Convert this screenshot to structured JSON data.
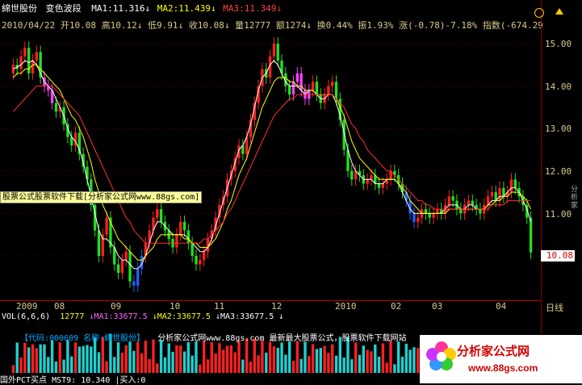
{
  "header": {
    "stock_name": "綿世股份",
    "indicator_name": "变色波段",
    "ma1": "MA1:11.316",
    "ma2": "MA2:11.439",
    "ma3": "MA3:11.349",
    "ma1_color": "#ffffff",
    "ma2_color": "#ffff00",
    "ma3_color": "#ff4040"
  },
  "quote": {
    "date": "2010/04/22",
    "open": "开10.08",
    "high": "高10.12",
    "low": "低9.91",
    "close": "收10.08",
    "volume": "量12777",
    "amount": "额1274",
    "turnover": "换0.44%",
    "amplitude": "振1.93%",
    "change": "涨(-0.78)-7.18%",
    "index": "指数(-674.29"
  },
  "price_axis": {
    "labels": [
      "15.00",
      "14.00",
      "13.00",
      "12.00",
      "11.00",
      "10.00"
    ],
    "current": "10.08"
  },
  "time_axis": {
    "labels": [
      "2009",
      "08",
      "09",
      "10",
      "11",
      "12",
      "2010",
      "02",
      "03",
      "04"
    ],
    "period": "日线"
  },
  "volume_row": {
    "label": "VOL(6,6,6)",
    "value": "12777",
    "ma1": "MA1:33677.5",
    "ma2": "MA2:33677.5",
    "ma3": "MA3:33677.5"
  },
  "ad_overlay": "股票公式股票软件下载[分析家公式网www.88gs.com]",
  "banner": {
    "code_text": "【代码:000609 名称:綿世股份】",
    "site_text": "分析家公式网www.88gs.com 最新最大股票公式，股票软件下载网站"
  },
  "logo": {
    "name": "分析家公式网",
    "url": "www.88gs.com"
  },
  "bottom_row": "国外PCT买点  MST9: 10.340 |买入:0",
  "right_side_text": "分析家",
  "chart_data": {
    "type": "candlestick",
    "title": "",
    "ylim": [
      9.0,
      15.5
    ],
    "y_ticks": [
      10,
      11,
      12,
      13,
      14,
      15
    ],
    "x_labels": [
      "2009",
      "08",
      "09",
      "10",
      "11",
      "12",
      "2010",
      "02",
      "03",
      "04"
    ],
    "closes": [
      14.5,
      14.4,
      14.7,
      14.9,
      14.3,
      14.6,
      14.8,
      14.2,
      14.0,
      13.9,
      13.6,
      13.4,
      13.5,
      13.1,
      12.8,
      12.6,
      12.9,
      12.4,
      12.1,
      11.8,
      11.2,
      10.6,
      10.0,
      10.5,
      10.9,
      10.2,
      9.8,
      9.6,
      9.9,
      10.1,
      9.4,
      9.3,
      9.7,
      10.0,
      10.3,
      10.6,
      10.9,
      11.1,
      10.8,
      10.6,
      10.4,
      10.2,
      10.5,
      10.8,
      10.6,
      10.3,
      10.0,
      9.8,
      9.9,
      10.1,
      10.4,
      10.6,
      10.9,
      11.2,
      11.4,
      11.8,
      12.0,
      12.3,
      12.6,
      12.4,
      12.8,
      13.2,
      13.6,
      14.0,
      14.4,
      14.2,
      14.7,
      15.0,
      14.6,
      14.3,
      14.0,
      13.8,
      14.1,
      14.3,
      13.9,
      13.7,
      13.9,
      14.1,
      13.8,
      13.6,
      13.8,
      14.0,
      14.1,
      13.7,
      13.2,
      12.5,
      12.0,
      11.8,
      12.0,
      11.9,
      11.7,
      11.8,
      11.9,
      11.7,
      11.6,
      11.7,
      11.8,
      12.0,
      11.9,
      11.7,
      11.5,
      11.3,
      11.0,
      10.8,
      10.9,
      11.1,
      11.0,
      10.9,
      11.0,
      11.1,
      11.0,
      11.2,
      11.4,
      11.3,
      11.1,
      11.0,
      11.2,
      11.3,
      11.2,
      11.1,
      11.0,
      11.2,
      11.4,
      11.5,
      11.3,
      11.6,
      11.4,
      11.5,
      11.8,
      11.6,
      11.4,
      11.2,
      10.9,
      10.08
    ],
    "ma1": [
      14.4,
      14.45,
      14.5,
      14.6,
      14.55,
      14.6,
      14.5,
      14.3,
      14.1,
      14.0,
      13.9,
      13.7,
      13.5,
      13.3,
      13.0,
      12.8,
      12.7,
      12.5,
      12.2,
      11.8,
      11.4,
      11.0,
      10.6,
      10.4,
      10.4,
      10.3,
      10.2,
      10.0,
      9.9,
      9.9,
      9.8,
      9.7,
      9.7,
      9.8,
      10.0,
      10.3,
      10.6,
      10.8,
      10.8,
      10.7,
      10.6,
      10.5,
      10.5,
      10.5,
      10.5,
      10.4,
      10.3,
      10.2,
      10.1,
      10.1,
      10.2,
      10.4,
      10.7,
      11.0,
      11.3,
      11.6,
      11.9,
      12.2,
      12.5,
      12.6,
      12.8,
      13.1,
      13.5,
      13.9,
      14.2,
      14.3,
      14.5,
      14.6,
      14.5,
      14.3,
      14.1,
      14.0,
      14.0,
      14.0,
      13.9,
      13.8,
      13.9,
      13.9,
      13.8,
      13.7,
      13.7,
      13.8,
      13.8,
      13.6,
      13.3,
      12.9,
      12.5,
      12.2,
      12.0,
      11.9,
      11.8,
      11.8,
      11.8,
      11.7,
      11.7,
      11.7,
      11.8,
      11.8,
      11.8,
      11.7,
      11.5,
      11.3,
      11.1,
      11.0,
      11.0,
      11.0,
      11.0,
      11.0,
      11.0,
      11.0,
      11.0,
      11.1,
      11.2,
      11.2,
      11.2,
      11.1,
      11.1,
      11.2,
      11.2,
      11.1,
      11.1,
      11.1,
      11.2,
      11.3,
      11.3,
      11.4,
      11.4,
      11.5,
      11.6,
      11.6,
      11.5,
      11.3,
      11.1,
      10.8
    ],
    "ma2": [
      14.2,
      14.3,
      14.3,
      14.4,
      14.4,
      14.5,
      14.5,
      14.4,
      14.3,
      14.2,
      14.1,
      14.0,
      13.9,
      13.7,
      13.5,
      13.3,
      13.2,
      13.0,
      12.8,
      12.5,
      12.2,
      11.8,
      11.5,
      11.2,
      11.0,
      10.8,
      10.6,
      10.4,
      10.3,
      10.2,
      10.1,
      10.0,
      9.9,
      9.9,
      10.0,
      10.1,
      10.2,
      10.4,
      10.5,
      10.5,
      10.5,
      10.5,
      10.5,
      10.5,
      10.4,
      10.4,
      10.3,
      10.3,
      10.2,
      10.2,
      10.2,
      10.3,
      10.4,
      10.6,
      10.8,
      11.1,
      11.3,
      11.6,
      11.9,
      12.1,
      12.3,
      12.6,
      12.9,
      13.2,
      13.5,
      13.7,
      13.9,
      14.1,
      14.2,
      14.2,
      14.2,
      14.1,
      14.1,
      14.0,
      14.0,
      13.9,
      13.9,
      13.9,
      13.8,
      13.8,
      13.8,
      13.8,
      13.8,
      13.7,
      13.5,
      13.3,
      13.0,
      12.7,
      12.5,
      12.3,
      12.2,
      12.1,
      12.0,
      11.9,
      11.8,
      11.8,
      11.8,
      11.8,
      11.8,
      11.7,
      11.6,
      11.5,
      11.3,
      11.2,
      11.1,
      11.0,
      11.0,
      11.0,
      11.0,
      11.0,
      11.0,
      11.0,
      11.1,
      11.1,
      11.1,
      11.1,
      11.1,
      11.1,
      11.1,
      11.1,
      11.1,
      11.1,
      11.2,
      11.2,
      11.3,
      11.3,
      11.4,
      11.4,
      11.5,
      11.5,
      11.5,
      11.4,
      11.3,
      11.1
    ],
    "ma3": [
      13.4,
      13.5,
      13.6,
      13.7,
      13.8,
      13.9,
      14.0,
      14.0,
      14.0,
      14.0,
      14.0,
      13.9,
      13.8,
      13.7,
      13.6,
      13.5,
      13.4,
      13.3,
      13.1,
      12.9,
      12.7,
      12.5,
      12.3,
      12.1,
      11.9,
      11.7,
      11.5,
      11.3,
      11.1,
      10.9,
      10.8,
      10.6,
      10.5,
      10.4,
      10.3,
      10.3,
      10.3,
      10.3,
      10.3,
      10.3,
      10.3,
      10.3,
      10.3,
      10.3,
      10.3,
      10.3,
      10.3,
      10.3,
      10.3,
      10.4,
      10.4,
      10.5,
      10.6,
      10.7,
      10.8,
      11.0,
      11.1,
      11.3,
      11.5,
      11.7,
      11.9,
      12.1,
      12.3,
      12.5,
      12.7,
      12.9,
      13.1,
      13.3,
      13.4,
      13.5,
      13.6,
      13.7,
      13.7,
      13.8,
      13.8,
      13.8,
      13.8,
      13.8,
      13.8,
      13.8,
      13.8,
      13.8,
      13.8,
      13.7,
      13.6,
      13.5,
      13.3,
      13.1,
      13.0,
      12.8,
      12.7,
      12.5,
      12.4,
      12.3,
      12.2,
      12.1,
      12.0,
      12.0,
      11.9,
      11.8,
      11.7,
      11.6,
      11.5,
      11.4,
      11.3,
      11.3,
      11.2,
      11.2,
      11.1,
      11.1,
      11.1,
      11.1,
      11.1,
      11.1,
      11.1,
      11.1,
      11.1,
      11.1,
      11.1,
      11.1,
      11.1,
      11.1,
      11.1,
      11.2,
      11.2,
      11.2,
      11.2,
      11.3,
      11.3,
      11.3,
      11.3,
      11.3,
      11.3,
      11.3
    ]
  }
}
